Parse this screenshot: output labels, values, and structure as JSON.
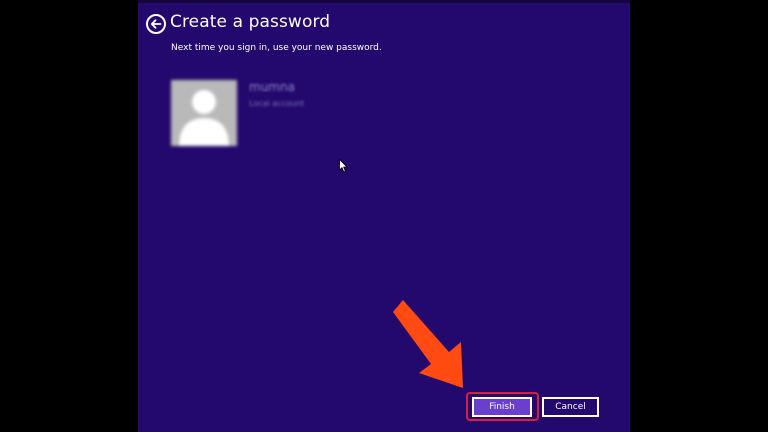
{
  "header": {
    "title": "Create a password",
    "subtitle": "Next time you sign in, use your new password."
  },
  "account": {
    "name": "mumna",
    "type": "Local account"
  },
  "footer": {
    "finish_label": "Finish",
    "cancel_label": "Cancel"
  },
  "icons": {
    "back": "back-arrow-icon",
    "avatar": "user-silhouette-icon",
    "cursor": "mouse-pointer-icon",
    "annotation": "orange-arrow-icon"
  },
  "colors": {
    "background": "#23096d",
    "finish_button": "#6a3fd0",
    "annotation_arrow": "#ff4a12",
    "highlight_border": "#d91f3d",
    "text": "#ffffff"
  }
}
